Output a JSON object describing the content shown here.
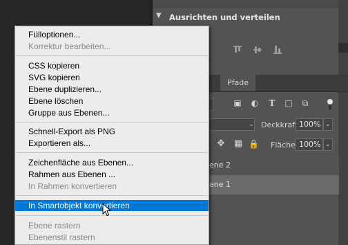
{
  "panel": {
    "align_title": "Ausrichten und verteilen",
    "tabs": [
      "Pfade"
    ],
    "blend_mode": "",
    "opacity_label": "Deckkraft:",
    "opacity_value": "100%",
    "fill_label": "Fläche:",
    "fill_value": "100%",
    "layers": [
      {
        "name": "ene 2",
        "selected": false
      },
      {
        "name": "ene 1",
        "selected": true
      }
    ]
  },
  "context_menu": {
    "items": [
      {
        "label": "Fülloptionen...",
        "disabled": false
      },
      {
        "label": "Korrektur bearbeiten...",
        "disabled": true
      },
      {
        "label": "CSS kopieren",
        "disabled": false
      },
      {
        "label": "SVG kopieren",
        "disabled": false
      },
      {
        "label": "Ebene duplizieren...",
        "disabled": false
      },
      {
        "label": "Ebene löschen",
        "disabled": false
      },
      {
        "label": "Gruppe aus Ebenen...",
        "disabled": false
      },
      {
        "label": "Schnell-Export als PNG",
        "disabled": false
      },
      {
        "label": "Exportieren als...",
        "disabled": false
      },
      {
        "label": "Zeichenfläche aus Ebenen...",
        "disabled": false
      },
      {
        "label": "Rahmen aus Ebenen ...",
        "disabled": false
      },
      {
        "label": "In Rahmen konvertieren",
        "disabled": true
      },
      {
        "label": "In Smartobjekt konvertieren",
        "disabled": false,
        "highlighted": true
      },
      {
        "label": "Ebene rastern",
        "disabled": true
      },
      {
        "label": "Ebenenstil rastern",
        "disabled": true
      }
    ]
  },
  "colors": {
    "highlight": "#0078d7",
    "menu_bg": "#ececec",
    "panel_bg": "#535353"
  }
}
